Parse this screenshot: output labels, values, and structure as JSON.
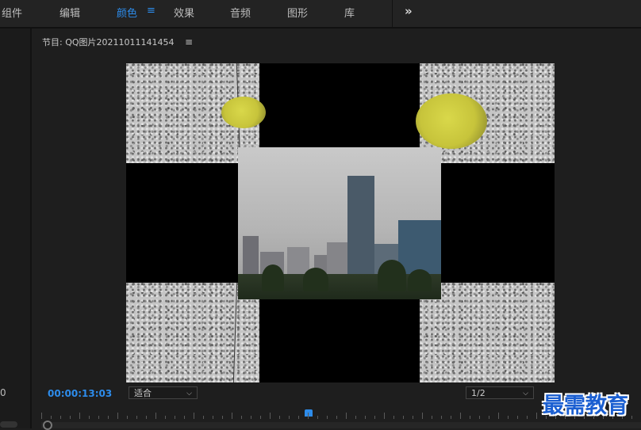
{
  "tabs": [
    {
      "label": "组件"
    },
    {
      "label": "编辑"
    },
    {
      "label": "颜色",
      "active": true
    },
    {
      "label": "效果"
    },
    {
      "label": "音频"
    },
    {
      "label": "图形"
    },
    {
      "label": "库"
    }
  ],
  "tab_menu_glyph": "≡",
  "more_glyph": "»",
  "left_panel": {
    "value": "0"
  },
  "monitor": {
    "title": "节目: QQ图片20211011141454",
    "menu_glyph": "≡"
  },
  "controls": {
    "timecode": "00:00:13:03",
    "fit_select": "适合",
    "resolution_select": "1/2"
  },
  "watermark": "最需教育",
  "colors": {
    "accent": "#2d8ceb",
    "background": "#1e1e1e",
    "watermark": "#1b5fd1"
  },
  "icons": {
    "more": "double-chevron-right-icon",
    "menu": "hamburger-menu-icon",
    "dropdown": "chevron-down-icon"
  }
}
